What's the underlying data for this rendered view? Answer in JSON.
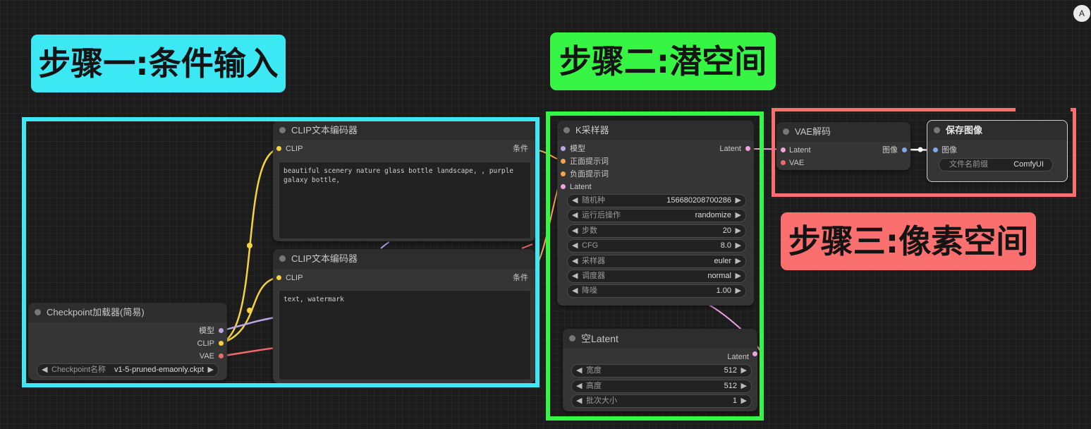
{
  "steps": {
    "one": "步骤一:条件输入",
    "two": "步骤二:潜空间",
    "three": "步骤三:像素空间"
  },
  "colors": {
    "step_one": "#3de8f5",
    "step_two": "#37f545",
    "step_three": "#fb6f6f",
    "pin_clip": "#f5d23e",
    "pin_model": "#b9a7e8",
    "pin_vae": "#f06a6a",
    "pin_latent": "#f0a2e0",
    "pin_cond": "#f5a64d",
    "pin_image": "#7da8f5"
  },
  "corner_icon": "A",
  "clip_node_1": {
    "title": "CLIP文本编码器",
    "input": "CLIP",
    "output": "条件",
    "text": "beautiful scenery nature glass bottle landscape, , purple galaxy bottle,"
  },
  "clip_node_2": {
    "title": "CLIP文本编码器",
    "input": "CLIP",
    "output": "条件",
    "text": "text, watermark"
  },
  "checkpoint_node": {
    "title": "Checkpoint加载器(简易)",
    "outputs": [
      "模型",
      "CLIP",
      "VAE"
    ],
    "widget_label": "Checkpoint名称",
    "widget_value": "v1-5-pruned-emaonly.ckpt"
  },
  "ksampler_node": {
    "title": "K采样器",
    "inputs": [
      "模型",
      "正面提示词",
      "负面提示词",
      "Latent"
    ],
    "output": "Latent",
    "widgets": [
      {
        "label": "随机种",
        "value": "156680208700286"
      },
      {
        "label": "运行后操作",
        "value": "randomize"
      },
      {
        "label": "步数",
        "value": "20"
      },
      {
        "label": "CFG",
        "value": "8.0"
      },
      {
        "label": "采样器",
        "value": "euler"
      },
      {
        "label": "调度器",
        "value": "normal"
      },
      {
        "label": "降噪",
        "value": "1.00"
      }
    ]
  },
  "empty_latent_node": {
    "title": "空Latent",
    "output": "Latent",
    "widgets": [
      {
        "label": "宽度",
        "value": "512"
      },
      {
        "label": "高度",
        "value": "512"
      },
      {
        "label": "批次大小",
        "value": "1"
      }
    ]
  },
  "vae_decode_node": {
    "title": "VAE解码",
    "inputs": [
      "Latent",
      "VAE"
    ],
    "output": "图像"
  },
  "save_image_node": {
    "title": "保存图像",
    "input": "图像",
    "widget_label": "文件名前缀",
    "widget_value": "ComfyUI"
  },
  "arrows": {
    "left": "◀",
    "right": "▶"
  }
}
